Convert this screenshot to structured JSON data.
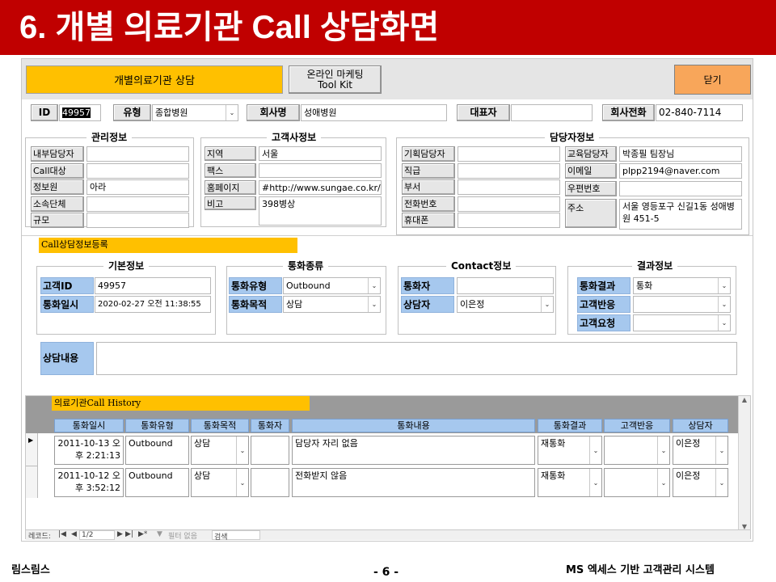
{
  "slide": {
    "title": "6. 개별 의료기관 Call 상담화면",
    "footer_left": "림스림스",
    "footer_center": "- 6 -",
    "footer_right": "MS 엑세스 기반 고객관리 시스템"
  },
  "toolbar": {
    "form_title": "개별의료기관 상담",
    "toolkit_line1": "온라인 마케팅",
    "toolkit_line2": "Tool Kit",
    "close_label": "닫기"
  },
  "header_fields": {
    "id_label": "ID",
    "id_value": "49957",
    "type_label": "유형",
    "type_value": "종합병원",
    "company_label": "회사명",
    "company_value": "성애병원",
    "ceo_label": "대표자",
    "ceo_value": "",
    "phone_label": "회사전화",
    "phone_value": "02-840-7114"
  },
  "mgmt": {
    "title": "관리정보",
    "rows": [
      {
        "label": "내부담당자",
        "value": ""
      },
      {
        "label": "Call대상",
        "value": ""
      },
      {
        "label": "정보원",
        "value": "아라"
      },
      {
        "label": "소속단체",
        "value": ""
      },
      {
        "label": "규모",
        "value": ""
      }
    ]
  },
  "customer": {
    "title": "고객사정보",
    "rows": [
      {
        "label": "지역",
        "value": "서울"
      },
      {
        "label": "팩스",
        "value": ""
      },
      {
        "label": "홈페이지",
        "value": "#http://www.sungae.co.kr/b"
      },
      {
        "label": "비고",
        "value": "398병상"
      }
    ]
  },
  "contact_person": {
    "title": "담당자정보",
    "left_rows": [
      {
        "label": "기획담당자",
        "value": ""
      },
      {
        "label": "직급",
        "value": ""
      },
      {
        "label": "부서",
        "value": ""
      },
      {
        "label": "전화번호",
        "value": ""
      },
      {
        "label": "휴대폰",
        "value": ""
      }
    ],
    "right_rows": [
      {
        "label": "교육담당자",
        "value": "박종필 팀장님"
      },
      {
        "label": "이메일",
        "value": "plpp2194@naver.com"
      },
      {
        "label": "우편번호",
        "value": ""
      },
      {
        "label": "주소",
        "value": "서울 영등포구 신길1동 성애병원 451-5"
      }
    ]
  },
  "call_reg": {
    "banner": "Call상담정보등록",
    "basic": {
      "title": "기본정보",
      "customer_id_label": "고객ID",
      "customer_id_value": "49957",
      "call_time_label": "통화일시",
      "call_time_value": "2020-02-27 오전 11:38:55"
    },
    "call_type": {
      "title": "통화종류",
      "type_label": "통화유형",
      "type_value": "Outbound",
      "purpose_label": "통화목적",
      "purpose_value": "상담"
    },
    "contact": {
      "title": "Contact정보",
      "caller_label": "통화자",
      "caller_value": "",
      "agent_label": "상담자",
      "agent_value": "이은정"
    },
    "result": {
      "title": "결과정보",
      "result_label": "통화결과",
      "result_value": "통화",
      "reaction_label": "고객반응",
      "reaction_value": "",
      "request_label": "고객요청",
      "request_value": ""
    },
    "content_label": "상담내용",
    "content_value": ""
  },
  "history": {
    "banner": "의료기관Call History",
    "columns": [
      "통화일시",
      "통화유형",
      "통화목적",
      "통화자",
      "통화내용",
      "통화결과",
      "고객반응",
      "상담자"
    ],
    "rows": [
      {
        "datetime": "2011-10-13 오후 2:21:13",
        "type": "Outbound",
        "purpose": "상담",
        "caller": "",
        "content": "담당자 자리 없음",
        "result": "재통화",
        "reaction": "",
        "agent": "이은정"
      },
      {
        "datetime": "2011-10-12 오후 3:52:12",
        "type": "Outbound",
        "purpose": "상담",
        "caller": "",
        "content": "전화받지 않음",
        "result": "재통화",
        "reaction": "",
        "agent": "이은정"
      }
    ],
    "nav": {
      "record_label": "레코드:",
      "position": "1/2",
      "filter_label": "필터 없음",
      "search_label": "검색"
    }
  },
  "colors": {
    "header_red": "#c00000",
    "accent_orange": "#ffc000",
    "close_orange": "#f8a65a",
    "label_blue": "#a6c8ee"
  }
}
